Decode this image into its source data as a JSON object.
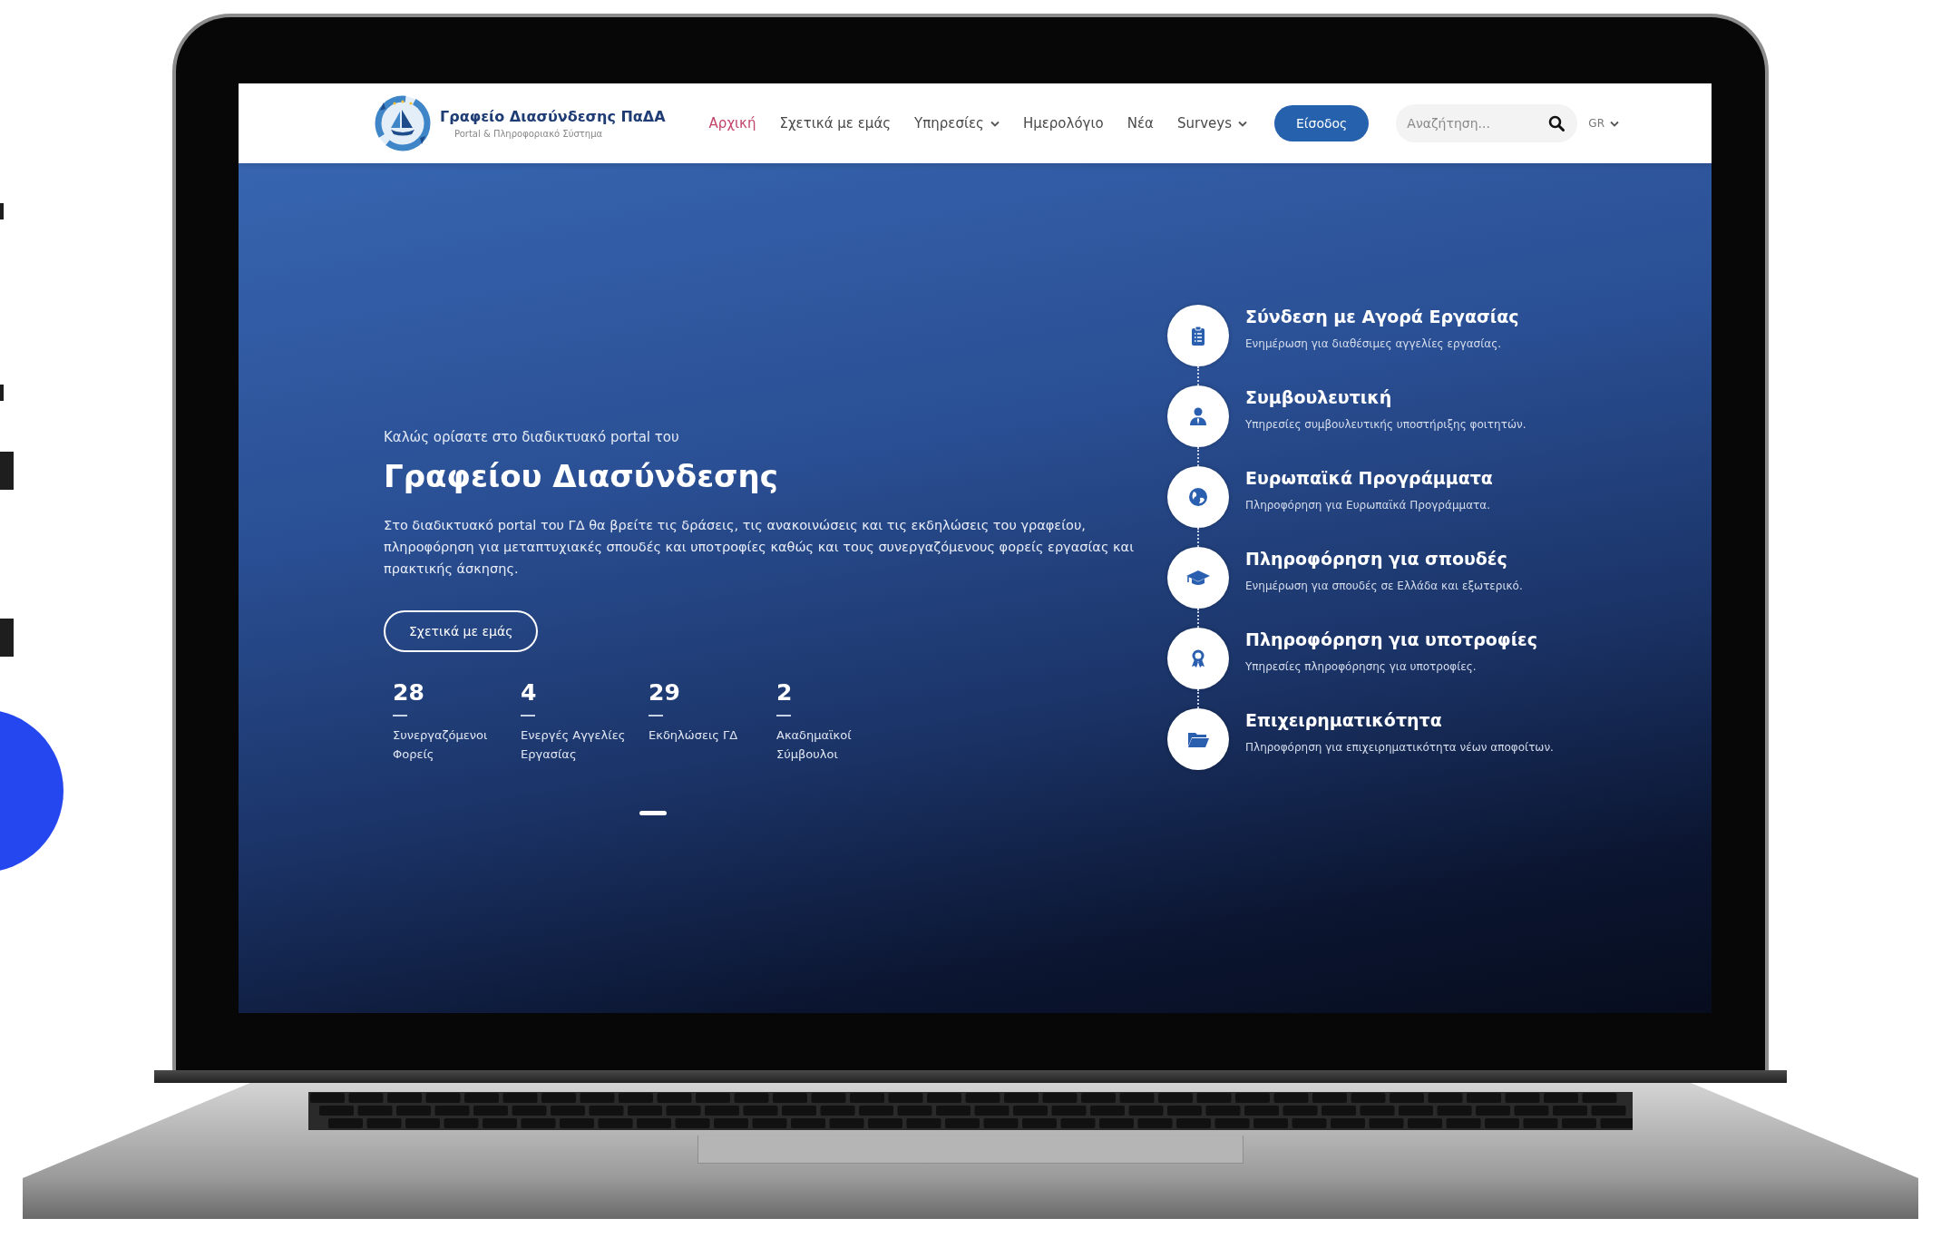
{
  "header": {
    "logo": {
      "title": "Γραφείο Διασύνδεσης ΠαΔΑ",
      "subtitle": "Portal & Πληροφοριακό Σύστημα"
    },
    "nav": [
      {
        "label": "Αρχική",
        "selected": true,
        "has_dropdown": false
      },
      {
        "label": "Σχετικά με εμάς",
        "selected": false,
        "has_dropdown": false
      },
      {
        "label": "Υπηρεσίες",
        "selected": false,
        "has_dropdown": true
      },
      {
        "label": "Ημερολόγιο",
        "selected": false,
        "has_dropdown": false
      },
      {
        "label": "Νέα",
        "selected": false,
        "has_dropdown": false
      },
      {
        "label": "Surveys",
        "selected": false,
        "has_dropdown": true
      }
    ],
    "login_button": "Είσοδος",
    "search": {
      "placeholder": "Αναζήτηση..."
    },
    "language": "GR"
  },
  "hero": {
    "welcome": "Καλώς ορίσατε στο διαδικτυακό portal του",
    "title": "Γραφείου Διασύνδεσης",
    "description": "Στο διαδικτυακό portal του ΓΔ θα βρείτε τις δράσεις, τις ανακοινώσεις και τις εκδηλώσεις του γραφείου, πληροφόρηση για μεταπτυχιακές σπουδές και υποτροφίες καθώς και τους συνεργαζόμενους φορείς εργασίας και πρακτικής άσκησης.",
    "button": "Σχετικά με εμάς",
    "stats": [
      {
        "value": "28",
        "label": "Συνεργαζόμενοι Φορείς"
      },
      {
        "value": "4",
        "label": "Ενεργές Αγγελίες Εργασίας"
      },
      {
        "value": "29",
        "label": "Εκδηλώσεις ΓΔ"
      },
      {
        "value": "2",
        "label": "Ακαδημαϊκοί Σύμβουλοι"
      }
    ]
  },
  "services": [
    {
      "title": "Σύνδεση με Αγορά Εργασίας",
      "description": "Ενημέρωση για διαθέσιμες αγγελίες εργασίας."
    },
    {
      "title": "Συμβουλευτική",
      "description": "Υπηρεσίες συμβουλευτικής υποστήριξης φοιτητών."
    },
    {
      "title": "Ευρωπαϊκά Προγράμματα",
      "description": "Πληροφόρηση για Ευρωπαϊκά Προγράμματα."
    },
    {
      "title": "Πληροφόρηση για σπουδές",
      "description": "Ενημέρωση για σπουδές σε Ελλάδα και εξωτερικό."
    },
    {
      "title": "Πληροφόρηση για υποτροφίες",
      "description": "Υπηρεσίες πληροφόρησης για υποτροφίες."
    },
    {
      "title": "Επιχειρηματικότητα",
      "description": "Πληροφόρηση για επιχειρηματικότητα νέων αποφοίτων."
    }
  ]
}
